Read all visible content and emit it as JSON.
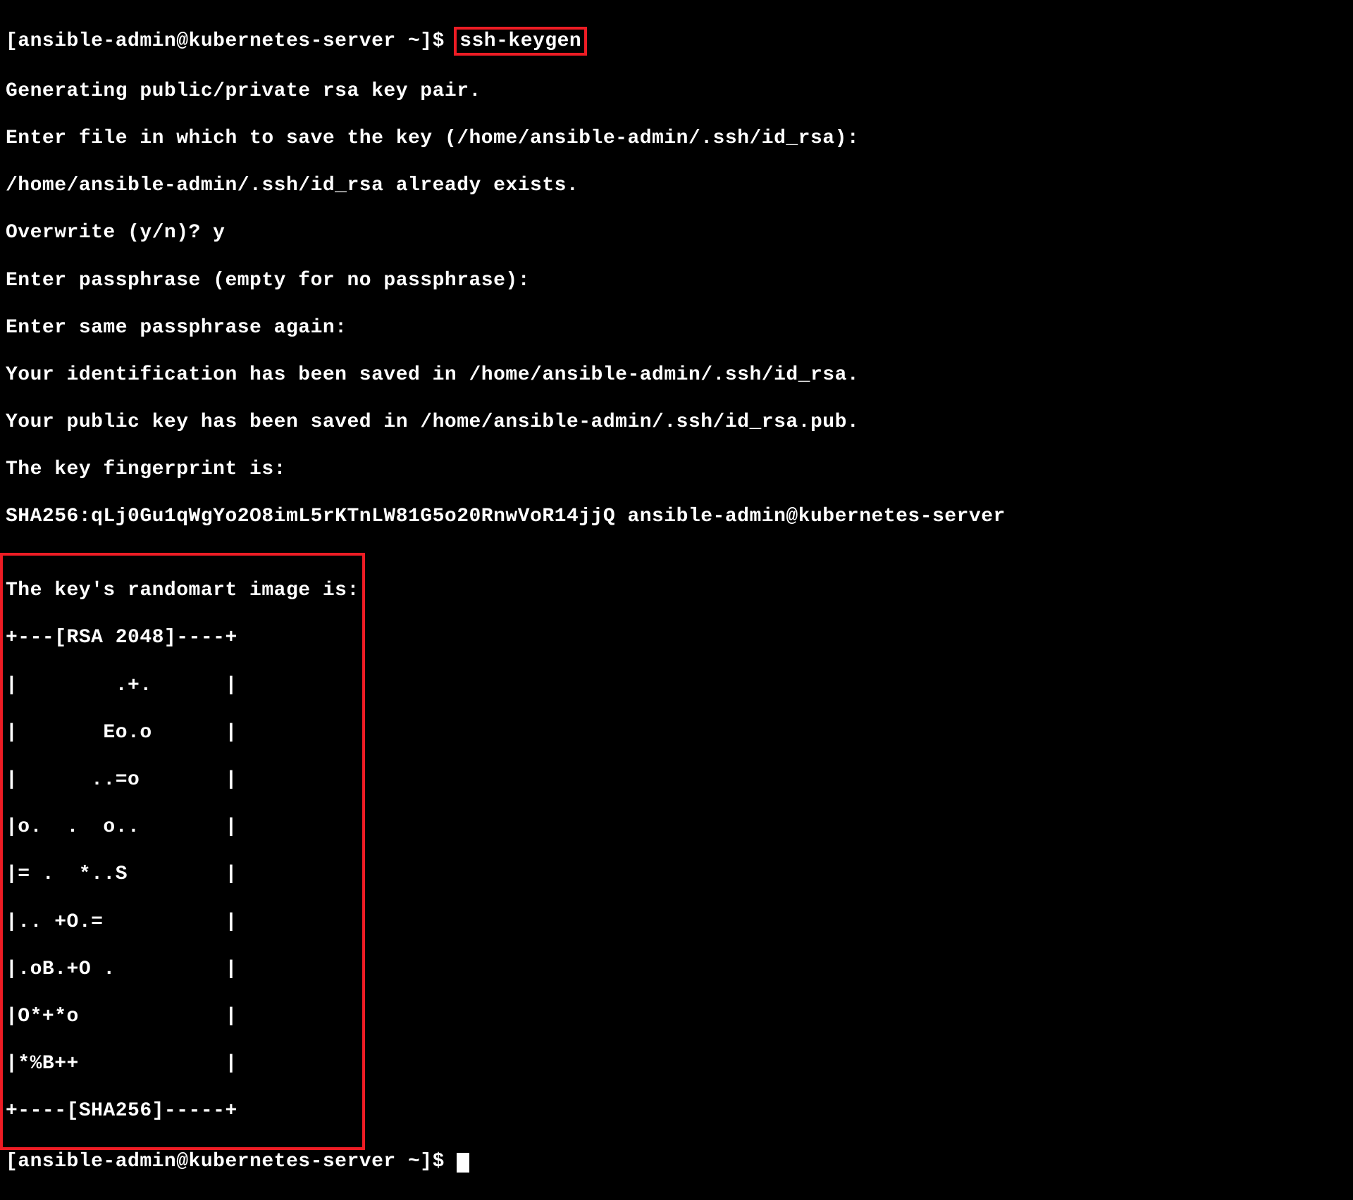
{
  "terminal": {
    "prompt1": "[ansible-admin@kubernetes-server ~]$ ",
    "command": "ssh-keygen",
    "lines": [
      "Generating public/private rsa key pair.",
      "Enter file in which to save the key (/home/ansible-admin/.ssh/id_rsa):",
      "/home/ansible-admin/.ssh/id_rsa already exists.",
      "Overwrite (y/n)? y",
      "Enter passphrase (empty for no passphrase):",
      "Enter same passphrase again:",
      "Your identification has been saved in /home/ansible-admin/.ssh/id_rsa.",
      "Your public key has been saved in /home/ansible-admin/.ssh/id_rsa.pub.",
      "The key fingerprint is:",
      "SHA256:qLj0Gu1qWgYo2O8imL5rKTnLW81G5o20RnwVoR14jjQ ansible-admin@kubernetes-server"
    ],
    "randomart": [
      "The key's randomart image is:",
      "+---[RSA 2048]----+",
      "|        .+.      |",
      "|       Eo.o      |",
      "|      ..=o       |",
      "|o.  .  o..       |",
      "|= .  *..S        |",
      "|.. +O.=          |",
      "|.oB.+O .         |",
      "|O*+*o            |",
      "|*%B++            |",
      "+----[SHA256]-----+"
    ],
    "prompt2": "[ansible-admin@kubernetes-server ~]$ "
  }
}
